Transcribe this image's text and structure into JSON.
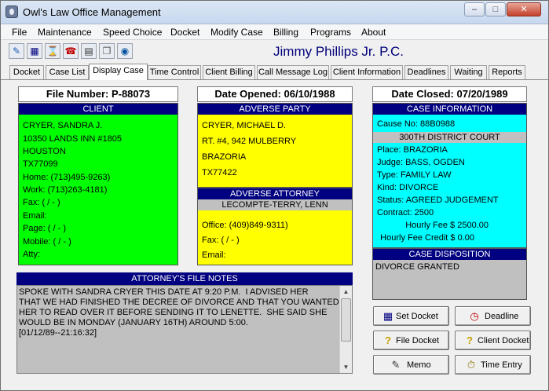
{
  "window": {
    "title": "Owl's Law Office Management"
  },
  "menu": [
    "File",
    "Maintenance",
    "Speed Choice",
    "Docket",
    "Modify Case",
    "Billing",
    "Programs",
    "About"
  ],
  "toolbar": {
    "icons": [
      "document-icon",
      "calendar-icon",
      "hourglass-icon",
      "phone-icon",
      "calculator-icon",
      "pages-icon",
      "globe-icon"
    ],
    "firm_name": "Jimmy Phillips Jr. P.C."
  },
  "tabs": [
    "Docket",
    "Case List",
    "Display Case",
    "Time Control",
    "Client Billing",
    "Call Message Log",
    "Client Information",
    "Deadlines",
    "Waiting",
    "Reports"
  ],
  "active_tab": "Display Case",
  "file_number": "File Number:  P-88073",
  "date_opened": "Date Opened:  06/10/1988",
  "date_closed": "Date Closed:  07/20/1989",
  "client": {
    "title": "CLIENT",
    "name": "CRYER, SANDRA J.",
    "address1": "10350 LANDS INN #1805",
    "city": "HOUSTON",
    "state_zip": "TX77099",
    "home": "Home:   (713)495-9263)",
    "work": "Work:   (713)263-4181)",
    "fax": "Fax:      (    /    -    )",
    "email": "Email:",
    "page": "Page:   (    /    -    )",
    "mobile": "Mobile:  (    /    -    )",
    "atty": "Atty:"
  },
  "adverse_party": {
    "title": "ADVERSE PARTY",
    "name": "CRYER, MICHAEL D.",
    "address1": "RT. #4, 942 MULBERRY",
    "city": "BRAZORIA",
    "state_zip": "TX77422"
  },
  "adverse_attorney": {
    "title": "ADVERSE ATTORNEY",
    "firm": "LECOMPTE-TERRY, LENN",
    "office": "Office:   (409)849-9311)",
    "fax": "Fax:      (    /    -    )",
    "email": "Email:"
  },
  "case_info": {
    "title": "CASE INFORMATION",
    "cause_no": "Cause No:  88B0988",
    "court": "300TH DISTRICT COURT",
    "place": "Place:  BRAZORIA",
    "judge": "Judge:  BASS, OGDEN",
    "type": "Type:   FAMILY LAW",
    "kind": "Kind:    DIVORCE",
    "status": "Status: AGREED JUDGEMENT",
    "contract": "Contract:  2500",
    "hourly_fee": "Hourly Fee $ 2500.00",
    "hourly_fee_credit": "Hourly Fee Credit $ 0.00"
  },
  "case_disposition": {
    "title": "CASE DISPOSITION",
    "text": "DIVORCE GRANTED"
  },
  "notes": {
    "title": "ATTORNEY'S FILE NOTES",
    "text": "SPOKE WITH SANDRA CRYER THIS DATE AT 9:20 P.M.  I ADVISED HER\nTHAT WE HAD FINISHED THE DECREE OF DIVORCE AND THAT YOU WANTED\nHER TO READ OVER IT BEFORE SENDING IT TO LENETTE.  SHE SAID SHE\nWOULD BE IN MONDAY (JANUARY 16TH) AROUND 5:00.\n[01/12/89--21:16:32]"
  },
  "buttons": {
    "set_docket": "Set Docket",
    "deadline": "Deadline",
    "file_docket": "File Docket",
    "client_docket": "Client Docket",
    "memo": "Memo",
    "time_entry": "Time Entry"
  },
  "colors": {
    "panel_title": "#000080",
    "client": "#00ff00",
    "adverse": "#ffff00",
    "case": "#00ffff",
    "firm_name": "#00007b"
  }
}
